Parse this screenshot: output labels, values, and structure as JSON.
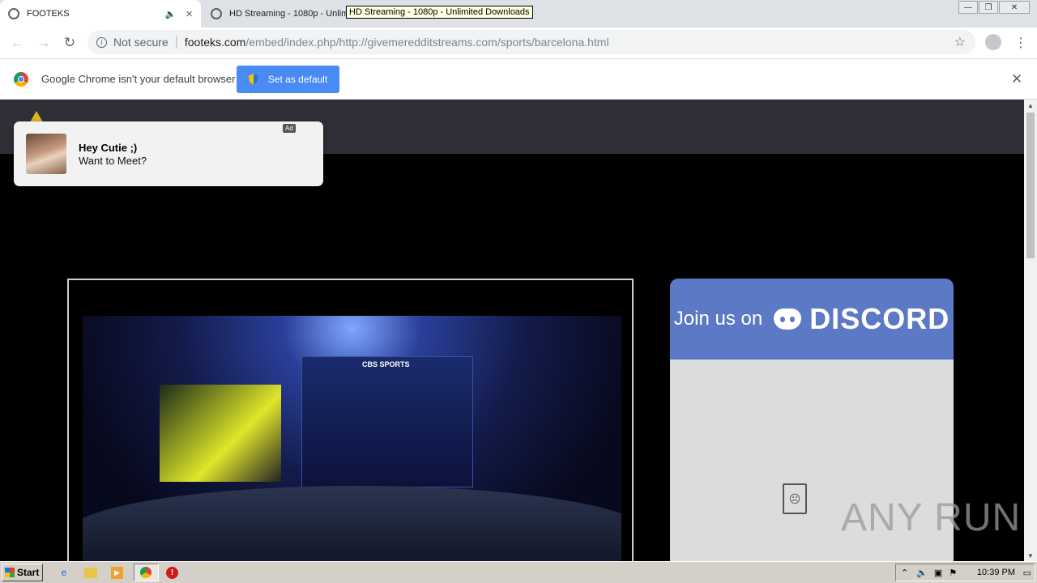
{
  "browser": {
    "tabs": [
      {
        "title": "FOOTEKS",
        "active": true
      },
      {
        "title": "HD Streaming - 1080p - Unlimit",
        "active": false
      }
    ],
    "tooltip": "HD Streaming - 1080p - Unlimited Downloads",
    "address": {
      "security_label": "Not secure",
      "host": "footeks.com",
      "path": "/embed/index.php/http://givemeredditstreams.com/sports/barcelona.html"
    },
    "infobar": {
      "message": "Google Chrome isn't your default browser",
      "button_label": "Set as default"
    }
  },
  "page": {
    "notification": {
      "badge": "Ad",
      "title": "Hey Cutie ;)",
      "message": "Want to Meet?"
    },
    "video": {
      "broadcaster": "CBS SPORTS"
    },
    "discord_banner": {
      "prefix": "Join us on",
      "brand": "DISCORD"
    },
    "watermark": "ANY RUN"
  },
  "taskbar": {
    "start_label": "Start",
    "clock": "10:39 PM"
  },
  "colors": {
    "page_bg": "#000000",
    "header_bg": "#2f3037",
    "discord_blue": "#5b79c4",
    "chrome_button_blue": "#4a8af4"
  }
}
